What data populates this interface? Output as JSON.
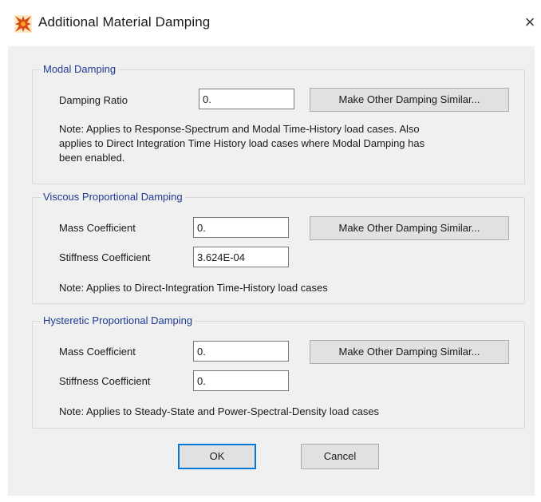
{
  "window": {
    "title": "Additional Material Damping",
    "close_glyph": "×",
    "icon": "app-logo-icon"
  },
  "modal": {
    "title": "Modal Damping",
    "damping_ratio_label": "Damping Ratio",
    "damping_ratio_value": "0.",
    "similar_button": "Make Other Damping Similar...",
    "note_line1": "Note:  Applies to Response-Spectrum and Modal Time-History load cases. Also",
    "note_line2": "applies to Direct Integration Time History load cases where Modal Damping has",
    "note_line3": "been enabled."
  },
  "viscous": {
    "title": "Viscous Proportional Damping",
    "mass_label": "Mass Coefficient",
    "mass_value": "0.",
    "stiffness_label": "Stiffness Coefficient",
    "stiffness_value": "3.624E-04",
    "similar_button": "Make Other Damping Similar...",
    "note": "Note:  Applies to Direct-Integration Time-History load cases"
  },
  "hysteretic": {
    "title": "Hysteretic Proportional Damping",
    "mass_label": "Mass Coefficient",
    "mass_value": "0.",
    "stiffness_label": "Stiffness Coefficient",
    "stiffness_value": "0.",
    "similar_button": "Make Other Damping Similar...",
    "note": "Note:  Applies to Steady-State and Power-Spectral-Density load cases"
  },
  "footer": {
    "ok": "OK",
    "cancel": "Cancel"
  },
  "colors": {
    "group_title": "#1f3a93",
    "dialog_bg": "#f0f0f0",
    "default_button_border": "#0078d7"
  }
}
